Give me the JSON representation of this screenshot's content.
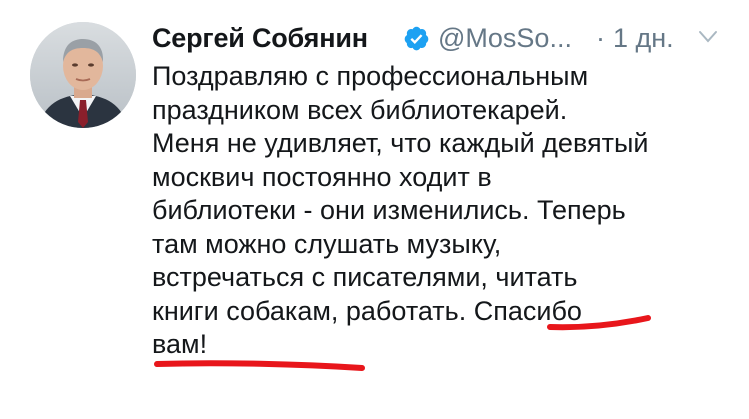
{
  "tweet": {
    "author_name": "Сергей Собянин",
    "handle": "@MosSo...",
    "separator": "·",
    "timestamp": "1 дн.",
    "lines": [
      "Поздравляю с профессиональным",
      "праздником всех библиотекарей.",
      "Меня не удивляет, что каждый девятый",
      "москвич постоянно ходит в",
      "библиотеки - они изменились. Теперь",
      "там можно слушать музыку,",
      "встречаться с писателями, читать",
      "книги собакам, работать. Спасибо",
      "вам!"
    ]
  },
  "colors": {
    "verified_badge": "#1da1f2",
    "handle_gray": "#657786",
    "underline_red": "#e8161b"
  },
  "icons": {
    "verified": "verified-badge-icon",
    "menu": "chevron-down-icon"
  }
}
